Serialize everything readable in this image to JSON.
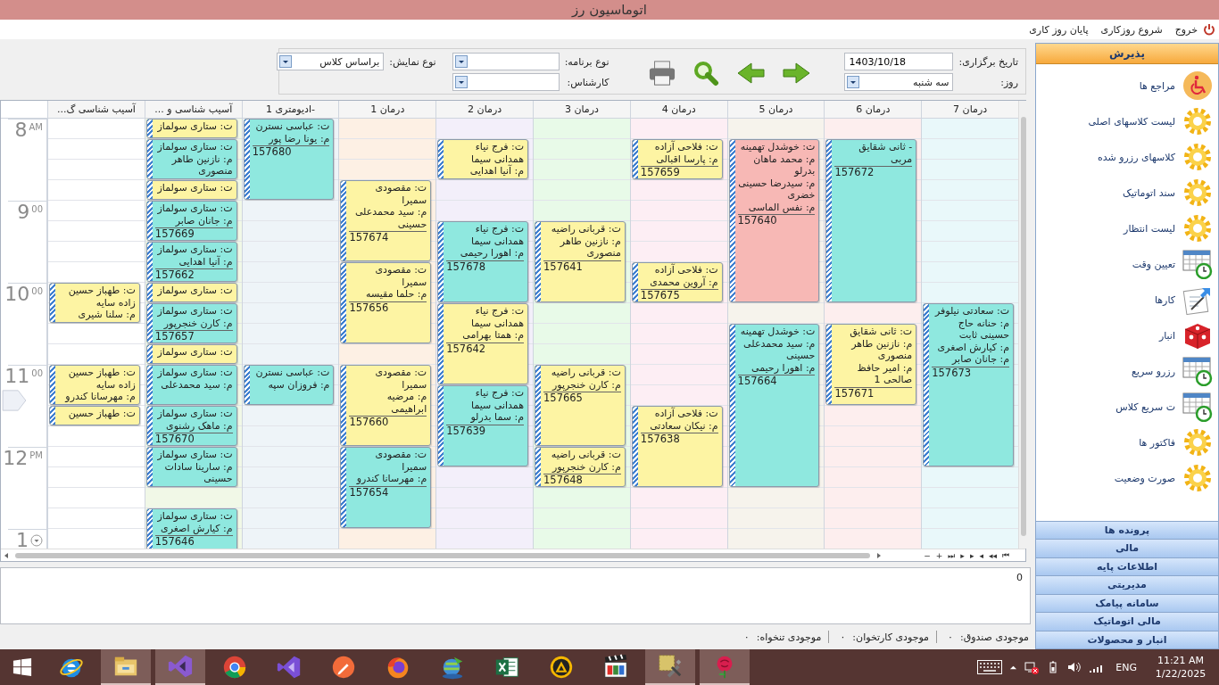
{
  "window": {
    "title": "اتوماسیون رز"
  },
  "menu": [
    {
      "kind": "exit",
      "label": "خروج"
    },
    {
      "kind": "plain",
      "label": "شروع روزکاری"
    },
    {
      "kind": "plain",
      "label": "پایان روز کاری"
    }
  ],
  "toolbar": {
    "date_label": "تاریخ برگزاری:",
    "date_value": "1403/10/18",
    "day_label": "روز:",
    "day_value": "سه شنبه",
    "actions": [
      {
        "kind": "next"
      },
      {
        "kind": "previous"
      },
      {
        "kind": "search"
      },
      {
        "kind": "print"
      }
    ],
    "program_type_label": "نوع برنامه:",
    "expert_label": "کارشناس:",
    "display_type_label": "نوع نمایش:",
    "display_type_value": "براساس کلاس"
  },
  "calendar": {
    "hours": [
      {
        "kind": "plain",
        "hour": "8",
        "suffix": "AM",
        "current": false
      },
      {
        "kind": "plain",
        "hour": "9",
        "suffix": "00",
        "current": false
      },
      {
        "kind": "plain",
        "hour": "10",
        "suffix": "00",
        "current": false
      },
      {
        "kind": "plain",
        "hour": "11",
        "suffix": "00",
        "current": true
      },
      {
        "kind": "plain",
        "hour": "12",
        "suffix": "PM",
        "current": false
      },
      {
        "kind": "expand",
        "hour": "1",
        "current": false
      }
    ],
    "columns": [
      {
        "title": "درمان 7",
        "color": "#e9f8fa",
        "items": [
          {
            "kind": "gap-two-hours"
          },
          {
            "kind": "gap-quarter"
          },
          {
            "kind": "two-hours",
            "color": "#8fe8df",
            "therapist": "ت: سعادتی نیلوفر",
            "clients": [
              "م: حنانه حاج حسینی ثابت",
              "م: کیارش اصغری",
              "م: جانان صابر"
            ],
            "number": "157673"
          }
        ]
      },
      {
        "title": "درمان 6",
        "color": "#fdeeee",
        "items": [
          {
            "kind": "gap-quarter"
          },
          {
            "kind": "two-hours",
            "color": "#8fe8df",
            "therapist": "- ثانی شقایق مربی",
            "number": "157672"
          },
          {
            "kind": "gap-quarter"
          },
          {
            "kind": "hour",
            "color": "#fdf4a3",
            "therapist": "ت: ثانی شقایق",
            "clients": [
              "م: نازنین طاهر منصوری",
              "م: امیر حافظ صالحی 1"
            ],
            "number": "157671"
          }
        ]
      },
      {
        "title": "درمان 5",
        "color": "#f6f3ec",
        "items": [
          {
            "kind": "gap-quarter"
          },
          {
            "kind": "two-hours",
            "color": "#f7b8b5",
            "therapist": "ت: خوشدل تهمینه",
            "clients": [
              "م: محمد ماهان بدرلو",
              "م: سیدرضا حسینی خضری",
              "م: نفس الماسی"
            ],
            "number": "157640"
          },
          {
            "kind": "gap-quarter"
          },
          {
            "kind": "two-hours",
            "color": "#8fe8df",
            "therapist": "ت: خوشدل تهمینه",
            "clients": [
              "م: سید محمدعلی حسینی",
              "م: اهورا رحیمی"
            ],
            "number": "157664"
          }
        ]
      },
      {
        "title": "درمان 4",
        "color": "#fdeef4",
        "items": [
          {
            "kind": "gap-quarter"
          },
          {
            "kind": "half",
            "color": "#fdf4a3",
            "therapist": "ت: فلاحی آزاده",
            "clients": [
              "م: پارسا اقبالی"
            ],
            "number": "157659"
          },
          {
            "kind": "gap-hour"
          },
          {
            "kind": "half",
            "color": "#fdf4a3",
            "therapist": "ت: فلاحی آزاده",
            "clients": [
              "م: آروین محمدی"
            ],
            "number": "157675"
          },
          {
            "kind": "gap-hour"
          },
          {
            "kind": "gap-quarter"
          },
          {
            "kind": "hour",
            "color": "#fdf4a3",
            "therapist": "ت: فلاحی آزاده",
            "clients": [
              "م: نیکان سعادتی"
            ],
            "number": "157638"
          }
        ]
      },
      {
        "title": "درمان 3",
        "color": "#e8fae8",
        "items": [
          {
            "kind": "gap-hour"
          },
          {
            "kind": "gap-quarter"
          },
          {
            "kind": "hour",
            "color": "#fdf4a3",
            "therapist": "ت: قربانی راضیه",
            "clients": [
              "م: نازنین طاهر منصوری"
            ],
            "number": "157641"
          },
          {
            "kind": "gap-half"
          },
          {
            "kind": "gap-quarter"
          },
          {
            "kind": "hour",
            "color": "#fdf4a3",
            "therapist": "ت: قربانی راضیه",
            "clients": [
              "م: کارن خنجرپور"
            ],
            "number": "157665"
          },
          {
            "kind": "half",
            "color": "#fdf4a3",
            "therapist": "ت: قربانی راضیه",
            "clients": [
              "م: کارن خنجرپور"
            ],
            "number": "157648"
          }
        ]
      },
      {
        "title": "درمان 2",
        "color": "#f3effa",
        "items": [
          {
            "kind": "gap-quarter"
          },
          {
            "kind": "half",
            "color": "#fdf4a3",
            "therapist": "ت: فرج نیاء همدانی سیما",
            "clients": [
              "م: آنیا اهدایی"
            ]
          },
          {
            "kind": "gap-half"
          },
          {
            "kind": "hour",
            "color": "#8fe8df",
            "therapist": "ت: فرج نیاء همدانی سیما",
            "clients": [
              "م: اهورا رحیمی"
            ],
            "number": "157678"
          },
          {
            "kind": "hour",
            "color": "#fdf4a3",
            "therapist": "ت: فرج نیاء همدانی سیما",
            "clients": [
              "م: همتا بهرامی"
            ],
            "number": "157642"
          },
          {
            "kind": "hour",
            "color": "#8fe8df",
            "therapist": "ت: فرج نیاء همدانی سیما",
            "clients": [
              "م: سما بدرلو"
            ],
            "number": "157639"
          }
        ]
      },
      {
        "title": "درمان 1",
        "color": "#fdf0e4",
        "items": [
          {
            "kind": "gap-half"
          },
          {
            "kind": "gap-quarter"
          },
          {
            "kind": "hour",
            "color": "#fdf4a3",
            "therapist": "ت: مقصودی سمیرا",
            "clients": [
              "م: سید محمدعلی حسینی"
            ],
            "number": "157674"
          },
          {
            "kind": "hour",
            "color": "#fdf4a3",
            "therapist": "ت: مقصودی سمیرا",
            "clients": [
              "م: حلما مقیسه"
            ],
            "number": "157656"
          },
          {
            "kind": "gap-quarter"
          },
          {
            "kind": "hour",
            "color": "#fdf4a3",
            "therapist": "ت: مقصودی سمیرا",
            "clients": [
              "م: مرضیه ابراهیمی"
            ],
            "number": "157660"
          },
          {
            "kind": "hour",
            "color": "#8fe8df",
            "therapist": "ت: مقصودی سمیرا",
            "clients": [
              "م: مهرسانا کندرو"
            ],
            "number": "157654"
          }
        ]
      },
      {
        "title": "-ادیومتری 1",
        "color": "#eef4f8",
        "items": [
          {
            "kind": "hour",
            "color": "#8fe8df",
            "therapist": "ت: عباسی نسترن",
            "clients": [
              "م: یونا رضا پور"
            ],
            "number": "157680"
          },
          {
            "kind": "gap-two-hours"
          },
          {
            "kind": "half",
            "color": "#8fe8df",
            "therapist": "ت: عباسی نسترن",
            "clients": [
              "م: فروزان سپه"
            ]
          }
        ]
      },
      {
        "title": "آسیب شناسی و ...",
        "color": "#f1f8e7",
        "items": [
          {
            "kind": "quarter",
            "color": "#fdf4a3",
            "therapist": "ت: ستاری سولماز"
          },
          {
            "kind": "half",
            "color": "#8fe8df",
            "therapist": "ت: ستاری سولماز",
            "clients": [
              "م: نازنین طاهر منصوری"
            ]
          },
          {
            "kind": "quarter",
            "color": "#fdf4a3",
            "therapist": "ت: ستاری سولماز"
          },
          {
            "kind": "half",
            "color": "#8fe8df",
            "therapist": "ت: ستاری سولماز",
            "clients": [
              "م: جانان صابر"
            ],
            "number": "157669"
          },
          {
            "kind": "half",
            "color": "#8fe8df",
            "therapist": "ت: ستاری سولماز",
            "clients": [
              "م: آنیا اهدایی"
            ],
            "number": "157662"
          },
          {
            "kind": "quarter",
            "color": "#fdf4a3",
            "therapist": "ت: ستاری سولماز"
          },
          {
            "kind": "half",
            "color": "#8fe8df",
            "therapist": "ت: ستاری سولماز",
            "clients": [
              "م: کارن خنجرپور"
            ],
            "number": "157657"
          },
          {
            "kind": "quarter",
            "color": "#fdf4a3",
            "therapist": "ت: ستاری سولماز"
          },
          {
            "kind": "half",
            "color": "#8fe8df",
            "therapist": "ت: ستاری سولماز",
            "clients": [
              "م: سید محمدعلی"
            ]
          },
          {
            "kind": "half",
            "color": "#8fe8df",
            "therapist": "ت: ستاری سولماز",
            "clients": [
              "م: ماهک رشنوی"
            ],
            "number": "157670"
          },
          {
            "kind": "half",
            "color": "#8fe8df",
            "therapist": "ت: ستاری سولماز",
            "clients": [
              "م: سارینا سادات حسینی"
            ]
          },
          {
            "kind": "gap-quarter"
          },
          {
            "kind": "hour",
            "color": "#8fe8df",
            "therapist": "ت: ستاری سولماز",
            "clients": [
              "م: کیارش اصغری"
            ],
            "number": "157646"
          }
        ]
      },
      {
        "title": "آسیب شناسی گ...",
        "color": "#ffffff",
        "items": [
          {
            "kind": "gap-two-hours"
          },
          {
            "kind": "half",
            "color": "#fdf4a3",
            "therapist": "ت: طهباز حسین زاده سایه",
            "clients": [
              "م: سلنا شیری"
            ]
          },
          {
            "kind": "gap-half"
          },
          {
            "kind": "half",
            "color": "#fdf4a3",
            "therapist": "ت: طهباز حسین زاده سایه",
            "clients": [
              "م: مهرسانا کندرو"
            ]
          },
          {
            "kind": "quarter",
            "color": "#fdf4a3",
            "therapist": "ت: طهباز حسین"
          }
        ]
      }
    ],
    "nav_buttons": [
      "⏮",
      "◂◂",
      "◂",
      "▸",
      "▸",
      "⏭",
      "+",
      "−"
    ]
  },
  "notes": {
    "value": "0"
  },
  "status": [
    {
      "label": "موجودی صندوق:",
      "value": "۰"
    },
    {
      "label": "موجودی کارتخوان:",
      "value": "۰"
    },
    {
      "label": "موجودی تنخواه:",
      "value": "۰"
    }
  ],
  "sidebar": {
    "header": "پذیرش",
    "items": [
      {
        "label": "مراجع ها",
        "kind": "wheelchair"
      },
      {
        "label": "لیست کلاسهای اصلی",
        "kind": "gear"
      },
      {
        "label": "کلاسهای رزرو شده",
        "kind": "gear"
      },
      {
        "label": "سند اتوماتیک",
        "kind": "gear"
      },
      {
        "label": "لیست انتظار",
        "kind": "gear"
      },
      {
        "label": "تعیین وقت",
        "kind": "calendar"
      },
      {
        "label": "کارها",
        "kind": "tasks"
      },
      {
        "label": "انبار",
        "kind": "box"
      },
      {
        "label": "رزرو سریع",
        "kind": "calendar"
      },
      {
        "label": "ت سریع کلاس",
        "kind": "calendar"
      },
      {
        "label": "فاکتور ها",
        "kind": "gear"
      },
      {
        "label": "صورت وضعیت",
        "kind": "gear"
      }
    ],
    "sections": [
      "پرونده ها",
      "مالی",
      "اطلاعات پایه",
      "مدیریتی",
      "سامانه پیامک",
      "مالی اتوماتیک",
      "انبار و محصولات"
    ]
  },
  "taskbar": {
    "apps": [
      {
        "kind": "ie",
        "active": false
      },
      {
        "kind": "explorer",
        "active": true
      },
      {
        "kind": "vs",
        "active": true
      },
      {
        "kind": "chrome",
        "active": false
      },
      {
        "kind": "vscode",
        "active": false
      },
      {
        "kind": "postman",
        "active": false
      },
      {
        "kind": "firefox",
        "active": false
      },
      {
        "kind": "idm",
        "active": false
      },
      {
        "kind": "excel",
        "active": false
      },
      {
        "kind": "aimp",
        "active": false
      },
      {
        "kind": "mpc",
        "active": false
      },
      {
        "kind": "tools",
        "active": true
      },
      {
        "kind": "rose",
        "active": true
      }
    ],
    "language": "ENG",
    "time": "11:21 AM",
    "date": "1/22/2025"
  }
}
